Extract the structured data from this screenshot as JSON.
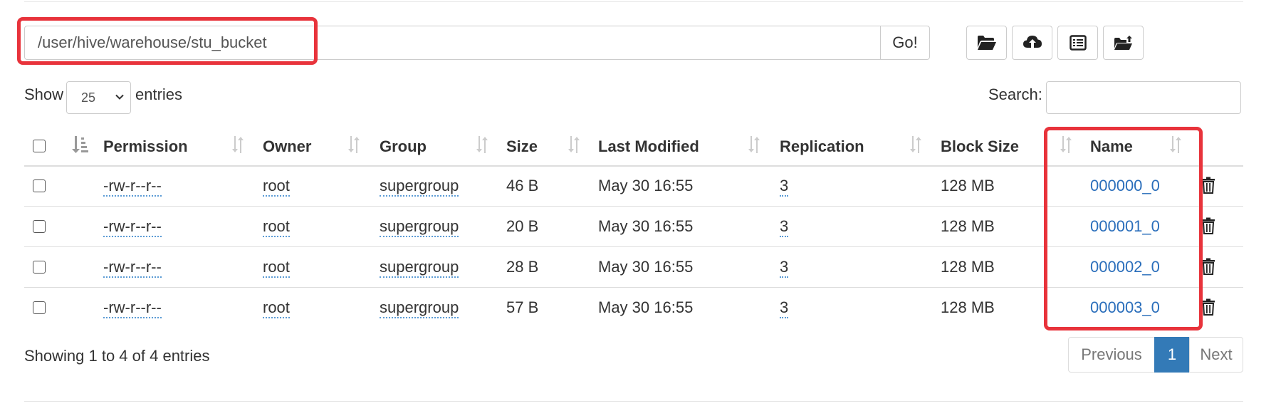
{
  "path": {
    "value": "/user/hive/warehouse/stu_bucket",
    "go_label": "Go!"
  },
  "toolbar": {
    "icons": [
      "folder-open-icon",
      "cloud-upload-icon",
      "list-icon",
      "folder-upload-icon"
    ]
  },
  "length_menu": {
    "show_label": "Show",
    "selected": "25",
    "entries_label": "entries"
  },
  "search": {
    "label": "Search:",
    "value": ""
  },
  "table": {
    "columns": [
      "Permission",
      "Owner",
      "Group",
      "Size",
      "Last Modified",
      "Replication",
      "Block Size",
      "Name"
    ],
    "rows": [
      {
        "permission": "-rw-r--r--",
        "owner": "root",
        "group": "supergroup",
        "size": "46 B",
        "modified": "May 30 16:55",
        "replication": "3",
        "block_size": "128 MB",
        "name": "000000_0"
      },
      {
        "permission": "-rw-r--r--",
        "owner": "root",
        "group": "supergroup",
        "size": "20 B",
        "modified": "May 30 16:55",
        "replication": "3",
        "block_size": "128 MB",
        "name": "000001_0"
      },
      {
        "permission": "-rw-r--r--",
        "owner": "root",
        "group": "supergroup",
        "size": "28 B",
        "modified": "May 30 16:55",
        "replication": "3",
        "block_size": "128 MB",
        "name": "000002_0"
      },
      {
        "permission": "-rw-r--r--",
        "owner": "root",
        "group": "supergroup",
        "size": "57 B",
        "modified": "May 30 16:55",
        "replication": "3",
        "block_size": "128 MB",
        "name": "000003_0"
      }
    ]
  },
  "footer": {
    "info": "Showing 1 to 4 of 4 entries"
  },
  "pagination": {
    "previous": "Previous",
    "current": "1",
    "next": "Next"
  },
  "colors": {
    "highlight": "#e8333b",
    "link": "#2a6ebb",
    "active_page": "#337ab7"
  }
}
